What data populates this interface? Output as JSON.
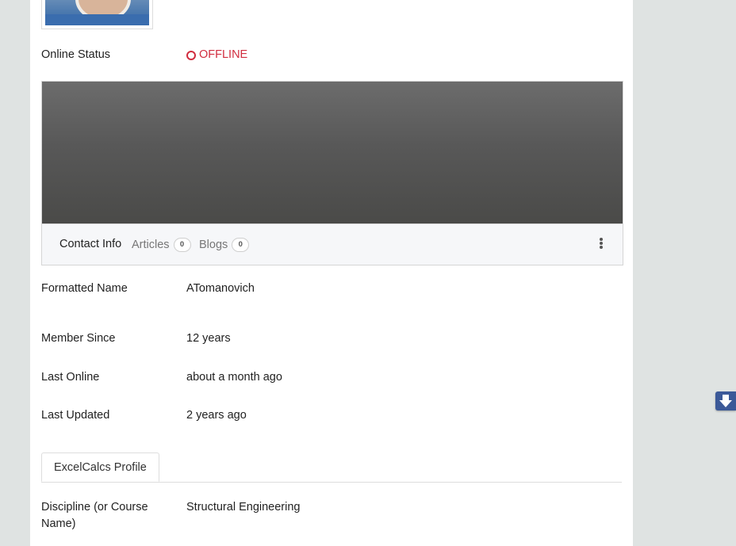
{
  "profile": {
    "online_status": {
      "label": "Online Status",
      "value": "OFFLINE",
      "color": "#d12d3f"
    }
  },
  "tabs": [
    {
      "label": "Contact Info"
    },
    {
      "label": "Articles",
      "count": "0"
    },
    {
      "label": "Blogs",
      "count": "0"
    }
  ],
  "fields": {
    "formatted_name": {
      "label": "Formatted Name",
      "value": "ATomanovich"
    },
    "member_since": {
      "label": "Member Since",
      "value": "12 years"
    },
    "last_online": {
      "label": "Last Online",
      "value": "about a month ago"
    },
    "last_updated": {
      "label": "Last Updated",
      "value": "2 years ago"
    }
  },
  "subtab": {
    "label": "ExcelCalcs Profile"
  },
  "discipline": {
    "label_line1": "Discipline (or Course",
    "label_line2": "Name)",
    "value": "Structural Engineering"
  },
  "icons": {
    "status": "circle-outline-icon",
    "menu": "vertical-dots-icon",
    "scroll": "arrow-down-icon"
  },
  "colors": {
    "page_bg": "#dfe3e2",
    "accent": "#3b5998"
  }
}
